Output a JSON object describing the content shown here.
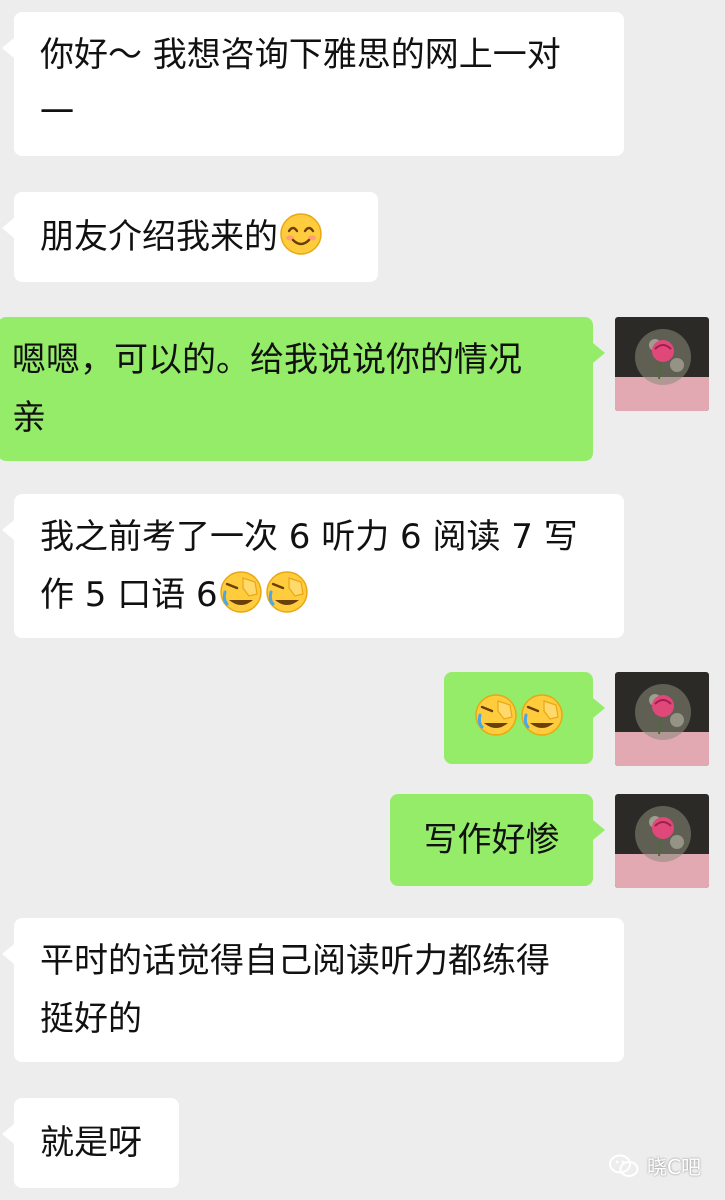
{
  "messages": [
    {
      "side": "recv",
      "lines": [
        "你好～ 我想咨询下雅思的网上一对",
        "一"
      ]
    },
    {
      "side": "recv",
      "lines": [
        "朋友介绍我来的"
      ],
      "emojis": [
        "smile"
      ]
    },
    {
      "side": "sent",
      "lines": [
        "嗯嗯，可以的。给我说说你的情况",
        "亲"
      ]
    },
    {
      "side": "recv",
      "lines": [
        "我之前考了一次 6 听力 6 阅读 7 写",
        "作 5 口语 6"
      ],
      "emojis": [
        "facepalm",
        "facepalm"
      ]
    },
    {
      "side": "sent",
      "lines": [],
      "emojis": [
        "facepalm",
        "facepalm"
      ]
    },
    {
      "side": "sent",
      "lines": [
        "写作好惨"
      ]
    },
    {
      "side": "recv",
      "lines": [
        "平时的话觉得自己阅读听力都练得",
        "挺好的"
      ]
    },
    {
      "side": "recv",
      "lines": [
        "就是呀"
      ]
    }
  ],
  "avatar": {
    "icon": "rose-photo-avatar"
  },
  "watermark": {
    "text": "晓C吧",
    "icon": "wechat-official-account-icon"
  },
  "colors": {
    "background": "#ededed",
    "received_bubble": "#ffffff",
    "sent_bubble": "#95ec69"
  }
}
